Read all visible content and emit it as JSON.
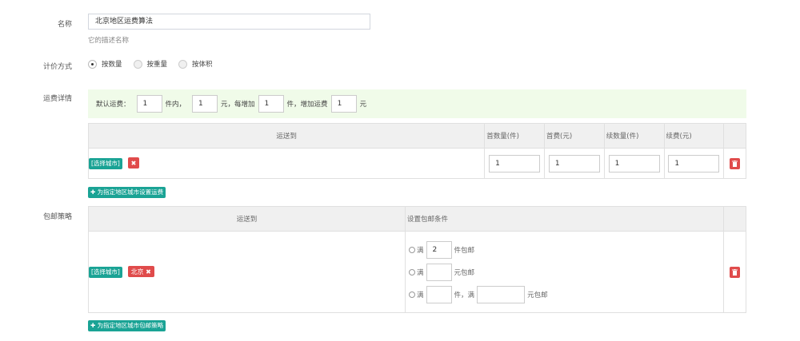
{
  "form": {
    "name_label": "名称",
    "name_value": "北京地区运费算法",
    "name_help": "它的描述名称",
    "pricing_label": "计价方式",
    "pricing_options": [
      {
        "label": "按数量",
        "selected": true
      },
      {
        "label": "按重量",
        "selected": false
      },
      {
        "label": "按体积",
        "selected": false
      }
    ],
    "freight_label": "运费详情",
    "default_freight": {
      "prefix": "默认运费：",
      "first_qty": "1",
      "unit1": "件内，",
      "first_fee": "1",
      "unit2": "元，每增加",
      "add_qty": "1",
      "unit3": "件，增加运费",
      "add_fee": "1",
      "unit4": "元"
    },
    "freight_table": {
      "headers": [
        "运送到",
        "首数量(件)",
        "首费(元)",
        "续数量(件)",
        "续费(元)"
      ],
      "rows": [
        {
          "select_city": "[选择城市]",
          "remove": "✖",
          "values": [
            "1",
            "1",
            "1",
            "1"
          ]
        }
      ]
    },
    "add_freight_button": "✚ 为指定地区城市设置运费",
    "free_label": "包邮策略",
    "free_table": {
      "headers": [
        "运送到",
        "设置包邮条件"
      ],
      "rows": [
        {
          "select_city": "[选择城市]",
          "city_tag": "北京 ✖",
          "conditions": [
            {
              "prefix": "满",
              "value": "2",
              "suffix": "件包邮"
            },
            {
              "prefix": "满",
              "value": "",
              "suffix": "元包邮"
            },
            {
              "prefix": "满",
              "value": "",
              "mid": "件，满",
              "value2": "",
              "suffix": "元包邮"
            }
          ]
        }
      ]
    },
    "add_free_button": "✚ 为指定地区城市包邮策略"
  }
}
